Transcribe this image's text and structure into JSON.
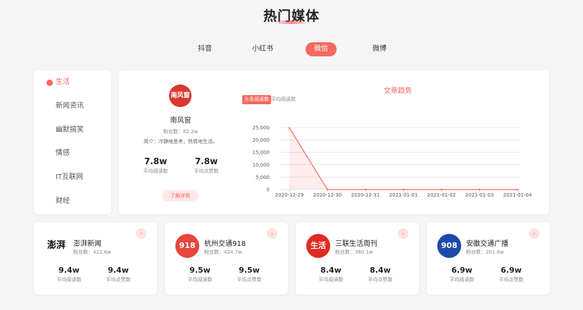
{
  "page": {
    "title": "热门媒体"
  },
  "tabs": [
    {
      "label": "抖音",
      "active": false
    },
    {
      "label": "小红书",
      "active": false
    },
    {
      "label": "微信",
      "active": true
    },
    {
      "label": "微博",
      "active": false
    }
  ],
  "sidebar": {
    "items": [
      {
        "label": "生活",
        "active": true
      },
      {
        "label": "新闻资讯",
        "active": false
      },
      {
        "label": "幽默搞笑",
        "active": false
      },
      {
        "label": "情感",
        "active": false
      },
      {
        "label": "IT互联网",
        "active": false
      },
      {
        "label": "财经",
        "active": false
      }
    ]
  },
  "featured": {
    "logo_text": "南风窗",
    "name": "南风窗",
    "fans_label": "粉丝数：",
    "fans_value": "82.2w",
    "intro_label": "简介：",
    "intro_text": "冷静地思考，热情地生活。",
    "stats": [
      {
        "value": "7.8w",
        "label": "平均阅读数"
      },
      {
        "value": "7.8w",
        "label": "平均点赞数"
      }
    ],
    "detail_button": "了解详情"
  },
  "chart_tabs": [
    {
      "label": "头条阅读数",
      "active": true
    },
    {
      "label": "平均阅读数",
      "active": false
    }
  ],
  "chart_data": {
    "type": "area",
    "title": "文章趋势",
    "categories": [
      "2020-12-29",
      "2020-12-30",
      "2020-12-31",
      "2021-01-01",
      "2021-01-02",
      "2021-01-03",
      "2021-01-04"
    ],
    "series": [
      {
        "values": [
          24800,
          0,
          0,
          0,
          0,
          0,
          0
        ]
      }
    ],
    "yticks": [
      "0",
      "5,000",
      "10,000",
      "15,000",
      "20,000",
      "25,000"
    ],
    "ylim": [
      0,
      25000
    ],
    "grid": true,
    "color": "#f4695f"
  },
  "cards": [
    {
      "name": "澎湃新闻",
      "logo_text": "澎湃",
      "fans_label": "粉丝数：",
      "fans_value": "422.6w",
      "read_value": "9.4w",
      "read_label": "平均阅读数",
      "like_value": "9.4w",
      "like_label": "平均点赞数"
    },
    {
      "name": "杭州交通918",
      "logo_text": "918",
      "fans_label": "粉丝数：",
      "fans_value": "424.7w",
      "read_value": "9.5w",
      "read_label": "平均阅读数",
      "like_value": "9.5w",
      "like_label": "平均点赞数"
    },
    {
      "name": "三联生活周刊",
      "logo_text": "生活",
      "fans_label": "粉丝数：",
      "fans_value": "360.1w",
      "read_value": "8.4w",
      "read_label": "平均阅读数",
      "like_value": "8.4w",
      "like_label": "平均点赞数"
    },
    {
      "name": "安徽交通广播",
      "logo_text": "908",
      "fans_label": "粉丝数：",
      "fans_value": "201.6w",
      "read_value": "6.9w",
      "read_label": "平均阅读数",
      "like_value": "6.9w",
      "like_label": "平均点赞数"
    }
  ],
  "colors": {
    "accent": "#f4695f",
    "accent_light": "#fde8e6",
    "background": "#f5f5f5"
  },
  "icons": {
    "card_arrow": "chevron-right-icon",
    "sidebar_active": "dot-icon"
  }
}
